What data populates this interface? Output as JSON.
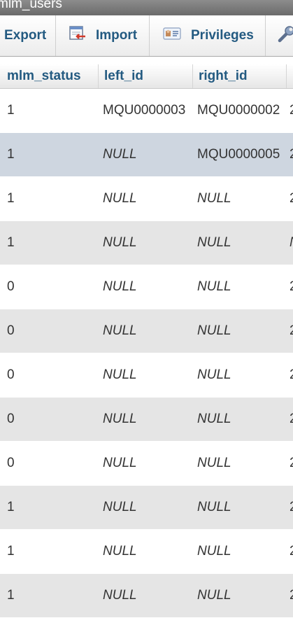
{
  "window": {
    "title": "mlm_users"
  },
  "tabs": [
    {
      "label": "Export",
      "icon": "export-icon"
    },
    {
      "label": "Import",
      "icon": "import-icon"
    },
    {
      "label": "Privileges",
      "icon": "privileges-icon"
    },
    {
      "label": "",
      "icon": "wrench-icon"
    }
  ],
  "table": {
    "columns": [
      "mlm_status",
      "left_id",
      "right_id",
      ""
    ],
    "rows": [
      {
        "mlm_status": "1",
        "left_id": "MQU0000003",
        "right_id": "MQU0000002",
        "next": "2"
      },
      {
        "mlm_status": "1",
        "left_id": "NULL",
        "right_id": "MQU0000005",
        "next": "2"
      },
      {
        "mlm_status": "1",
        "left_id": "NULL",
        "right_id": "NULL",
        "next": "2"
      },
      {
        "mlm_status": "1",
        "left_id": "NULL",
        "right_id": "NULL",
        "next": "N"
      },
      {
        "mlm_status": "0",
        "left_id": "NULL",
        "right_id": "NULL",
        "next": "2"
      },
      {
        "mlm_status": "0",
        "left_id": "NULL",
        "right_id": "NULL",
        "next": "2"
      },
      {
        "mlm_status": "0",
        "left_id": "NULL",
        "right_id": "NULL",
        "next": "2"
      },
      {
        "mlm_status": "0",
        "left_id": "NULL",
        "right_id": "NULL",
        "next": "2"
      },
      {
        "mlm_status": "0",
        "left_id": "NULL",
        "right_id": "NULL",
        "next": "2"
      },
      {
        "mlm_status": "1",
        "left_id": "NULL",
        "right_id": "NULL",
        "next": "2"
      },
      {
        "mlm_status": "1",
        "left_id": "NULL",
        "right_id": "NULL",
        "next": "2"
      },
      {
        "mlm_status": "1",
        "left_id": "NULL",
        "right_id": "NULL",
        "next": "2"
      }
    ]
  },
  "colors": {
    "accent": "#235a81",
    "row_even": "#e5e5e5",
    "row_marked": "#ced6e0"
  }
}
